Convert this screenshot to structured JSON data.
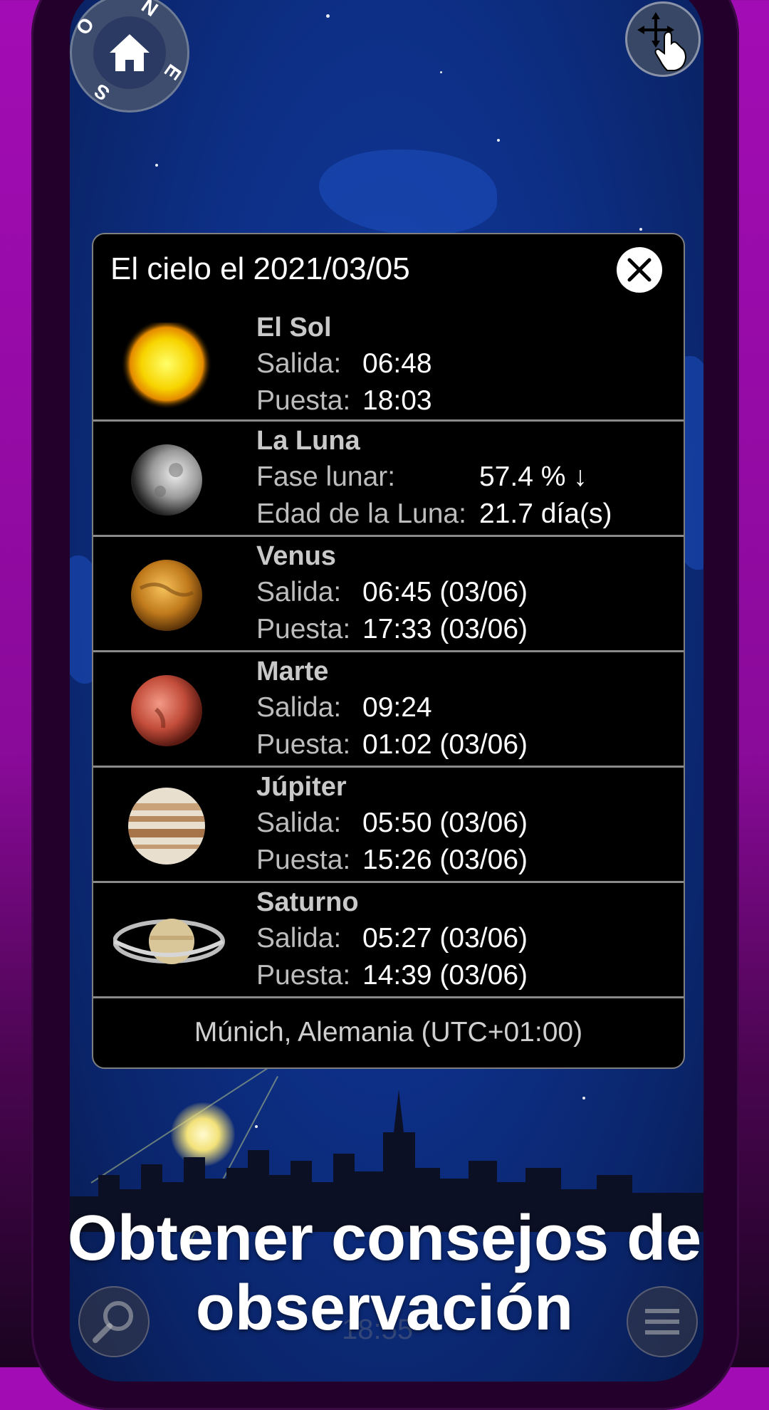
{
  "dialog": {
    "title": "El cielo el 2021/03/05",
    "rows": [
      {
        "name": "El Sol",
        "label1": "Salida:",
        "value1": "06:48",
        "label2": "Puesta:",
        "value2": "18:03"
      },
      {
        "name": "La Luna",
        "label1": "Fase lunar:",
        "value1": "57.4 % ↓",
        "label2": "Edad de la Luna:",
        "value2": "21.7 día(s)"
      },
      {
        "name": "Venus",
        "label1": "Salida:",
        "value1": "06:45 (03/06)",
        "label2": "Puesta:",
        "value2": "17:33 (03/06)"
      },
      {
        "name": "Marte",
        "label1": "Salida:",
        "value1": "09:24",
        "label2": "Puesta:",
        "value2": "01:02 (03/06)"
      },
      {
        "name": "Júpiter",
        "label1": "Salida:",
        "value1": "05:50 (03/06)",
        "label2": "Puesta:",
        "value2": "15:26 (03/06)"
      },
      {
        "name": "Saturno",
        "label1": "Salida:",
        "value1": "05:27 (03/06)",
        "label2": "Puesta:",
        "value2": "14:39 (03/06)"
      }
    ],
    "location": "Múnich, Alemania (UTC+01:00)"
  },
  "compass": {
    "letters": [
      "N",
      "E",
      "S",
      "O"
    ]
  },
  "caption": {
    "line1": "Obtener consejos de",
    "line2": "observación"
  },
  "clock": "18:55",
  "icons": {
    "home": "home-icon",
    "gesture": "move-gesture-icon",
    "close": "close-icon",
    "search": "search-icon",
    "menu": "menu-icon"
  },
  "colors": {
    "background": "#a20cb4",
    "sky": "#0d2f86",
    "dialog_bg": "#000000",
    "dialog_border": "#7f7f7f"
  }
}
